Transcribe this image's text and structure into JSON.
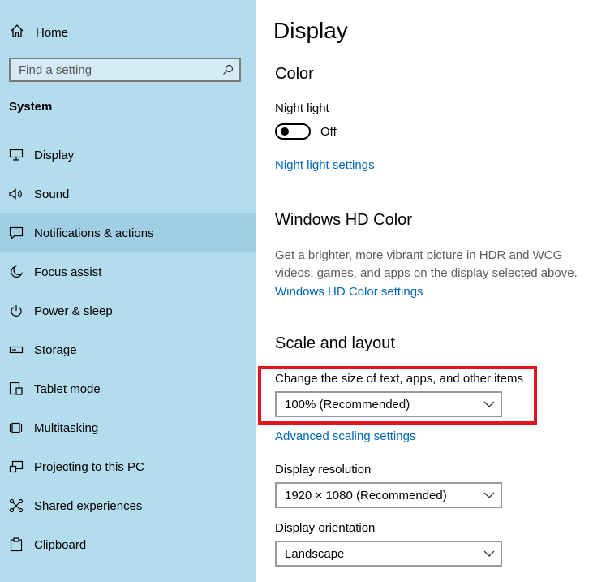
{
  "sidebar": {
    "home_label": "Home",
    "search_placeholder": "Find a setting",
    "section_title": "System",
    "items": [
      {
        "label": "Display",
        "icon": "monitor-icon"
      },
      {
        "label": "Sound",
        "icon": "speaker-icon"
      },
      {
        "label": "Notifications & actions",
        "icon": "notification-icon",
        "selected": true
      },
      {
        "label": "Focus assist",
        "icon": "moon-icon"
      },
      {
        "label": "Power & sleep",
        "icon": "power-icon"
      },
      {
        "label": "Storage",
        "icon": "storage-icon"
      },
      {
        "label": "Tablet mode",
        "icon": "tablet-mode-icon"
      },
      {
        "label": "Multitasking",
        "icon": "multitasking-icon"
      },
      {
        "label": "Projecting to this PC",
        "icon": "projecting-icon"
      },
      {
        "label": "Shared experiences",
        "icon": "shared-experiences-icon"
      },
      {
        "label": "Clipboard",
        "icon": "clipboard-icon"
      }
    ]
  },
  "main": {
    "title": "Display",
    "color": {
      "heading": "Color",
      "night_light_label": "Night light",
      "night_light_state": "Off",
      "night_light_on": false,
      "night_light_link": "Night light settings"
    },
    "hd_color": {
      "heading": "Windows HD Color",
      "description": "Get a brighter, more vibrant picture in HDR and WCG videos, games, and apps on the display selected above.",
      "link": "Windows HD Color settings"
    },
    "scale": {
      "heading": "Scale and layout",
      "size_label": "Change the size of text, apps, and other items",
      "size_value": "100% (Recommended)",
      "advanced_link": "Advanced scaling settings",
      "resolution_label": "Display resolution",
      "resolution_value": "1920 × 1080 (Recommended)",
      "orientation_label": "Display orientation",
      "orientation_value": "Landscape"
    }
  },
  "colors": {
    "sidebar_bg": "#b3dced",
    "selected_bg": "#a0cee3",
    "link": "#0067b8",
    "highlight": "#e3141c"
  }
}
